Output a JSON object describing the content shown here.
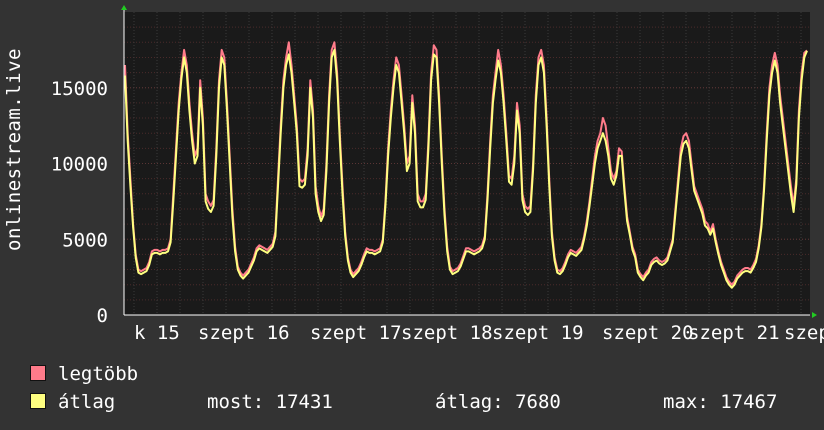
{
  "chart_data": {
    "type": "line",
    "ylabel": "onlinestream.live",
    "y_ticks": [
      0,
      5000,
      10000,
      15000
    ],
    "ylim": [
      0,
      20000
    ],
    "x_tick_labels": [
      "k 15",
      "szept 16",
      "szept 17",
      "szept 18",
      "szept 19",
      "szept 20",
      "szept 21",
      "szept"
    ],
    "grid": true,
    "series": [
      {
        "name": "legtöbb",
        "color": "#ff7b8a",
        "values": [
          16500,
          12000,
          9000,
          6000,
          4000,
          3000,
          2900,
          3000,
          3100,
          3500,
          4200,
          4300,
          4300,
          4200,
          4300,
          4300,
          4400,
          5000,
          8000,
          11000,
          14000,
          16000,
          17500,
          16500,
          14000,
          12000,
          10500,
          11000,
          15500,
          13000,
          8000,
          7500,
          7200,
          7600,
          11000,
          15500,
          17500,
          17000,
          14000,
          10500,
          7000,
          4500,
          3200,
          2800,
          2600,
          2800,
          3000,
          3400,
          3800,
          4400,
          4600,
          4500,
          4400,
          4300,
          4500,
          4700,
          5500,
          9000,
          12500,
          15500,
          17000,
          18000,
          16500,
          14500,
          12500,
          9000,
          8800,
          9000,
          11000,
          15500,
          13500,
          8500,
          7200,
          6500,
          7000,
          10000,
          14500,
          17500,
          18000,
          16000,
          12000,
          8500,
          5500,
          3800,
          3000,
          2700,
          2900,
          3100,
          3500,
          4000,
          4400,
          4300,
          4300,
          4200,
          4300,
          4400,
          5000,
          7500,
          11000,
          13500,
          15500,
          17000,
          16500,
          14500,
          12500,
          10000,
          10500,
          14500,
          12500,
          8000,
          7500,
          7500,
          8000,
          11500,
          16000,
          17800,
          17500,
          14500,
          10500,
          7000,
          4500,
          3200,
          2900,
          3000,
          3100,
          3400,
          3900,
          4400,
          4400,
          4300,
          4200,
          4300,
          4400,
          4600,
          5200,
          8000,
          11500,
          14500,
          16000,
          17500,
          16500,
          14500,
          12000,
          9200,
          9000,
          10500,
          14000,
          12500,
          8000,
          7200,
          7000,
          7200,
          10000,
          14500,
          17000,
          17500,
          16500,
          13000,
          9000,
          5500,
          3800,
          3000,
          2900,
          3100,
          3500,
          4000,
          4300,
          4200,
          4100,
          4300,
          4500,
          5200,
          6200,
          7500,
          9000,
          10500,
          11500,
          12000,
          13000,
          12500,
          11000,
          9500,
          9000,
          9500,
          11000,
          10800,
          8500,
          6500,
          5500,
          4500,
          4000,
          3000,
          2700,
          2500,
          2800,
          3000,
          3500,
          3700,
          3800,
          3600,
          3500,
          3600,
          3800,
          4400,
          5000,
          7000,
          9000,
          11000,
          11800,
          12000,
          11500,
          10000,
          8500,
          8000,
          7500,
          7000,
          6200,
          6000,
          5500,
          6000,
          5000,
          4200,
          3500,
          3000,
          2500,
          2200,
          2000,
          2200,
          2600,
          2800,
          3000,
          3100,
          3100,
          3000,
          3300,
          3700,
          4600,
          6000,
          8500,
          12000,
          15000,
          16500,
          17300,
          16500,
          14500,
          13000,
          11500,
          10000,
          8500,
          7200,
          9000,
          13500,
          16000,
          17300,
          17467
        ]
      },
      {
        "name": "átlag",
        "color": "#ffff80",
        "values": [
          15800,
          11500,
          8500,
          5800,
          3800,
          2800,
          2700,
          2800,
          2900,
          3300,
          4000,
          4100,
          4100,
          4000,
          4100,
          4100,
          4200,
          4800,
          7500,
          10500,
          13500,
          15600,
          17000,
          16000,
          13500,
          11500,
          10000,
          10500,
          15000,
          12500,
          7500,
          7000,
          6800,
          7200,
          10500,
          15000,
          17000,
          16500,
          13500,
          10000,
          6500,
          4200,
          3000,
          2600,
          2400,
          2600,
          2800,
          3200,
          3600,
          4200,
          4400,
          4300,
          4200,
          4100,
          4300,
          4500,
          5200,
          8500,
          12000,
          15000,
          16500,
          17200,
          16000,
          14000,
          12000,
          8500,
          8400,
          8600,
          10500,
          15000,
          13000,
          8000,
          6800,
          6200,
          6600,
          9500,
          14000,
          17000,
          17500,
          15500,
          11500,
          8000,
          5200,
          3600,
          2800,
          2500,
          2700,
          2900,
          3300,
          3800,
          4200,
          4100,
          4100,
          4000,
          4100,
          4200,
          4800,
          7200,
          10500,
          13000,
          15000,
          16500,
          16000,
          14000,
          12000,
          9500,
          10000,
          14000,
          12000,
          7500,
          7100,
          7100,
          7600,
          11000,
          15500,
          17200,
          17000,
          14000,
          10000,
          6600,
          4200,
          3000,
          2700,
          2800,
          2900,
          3200,
          3700,
          4200,
          4200,
          4100,
          4000,
          4100,
          4200,
          4400,
          5000,
          7600,
          11000,
          14000,
          15500,
          16800,
          16000,
          14000,
          11500,
          8800,
          8600,
          10000,
          13500,
          12000,
          7600,
          6800,
          6600,
          6800,
          9600,
          14000,
          16500,
          17000,
          16000,
          12500,
          8600,
          5200,
          3600,
          2800,
          2700,
          2900,
          3300,
          3800,
          4100,
          4000,
          3900,
          4100,
          4300,
          5000,
          5900,
          7200,
          8600,
          10000,
          11000,
          11500,
          12000,
          11500,
          10500,
          9000,
          8600,
          9200,
          10500,
          10500,
          8200,
          6200,
          5300,
          4300,
          3800,
          2800,
          2500,
          2300,
          2600,
          2800,
          3300,
          3500,
          3600,
          3400,
          3300,
          3400,
          3600,
          4200,
          4800,
          6700,
          8600,
          10500,
          11300,
          11500,
          11000,
          9600,
          8200,
          7700,
          7200,
          6700,
          5900,
          5700,
          5300,
          5700,
          4800,
          4000,
          3300,
          2800,
          2300,
          2000,
          1800,
          2000,
          2400,
          2600,
          2800,
          2900,
          2900,
          2800,
          3100,
          3500,
          4400,
          5800,
          8200,
          11500,
          14500,
          16000,
          16800,
          16000,
          14000,
          12500,
          11000,
          9500,
          8000,
          6800,
          8600,
          13000,
          15500,
          17000,
          17431
        ]
      }
    ]
  },
  "legend": {
    "max_label": "legtöbb",
    "avg_label": "átlag",
    "now_text": "most: 17431",
    "average_text": "átlag: 7680",
    "maximum_text": "max: 17467"
  }
}
